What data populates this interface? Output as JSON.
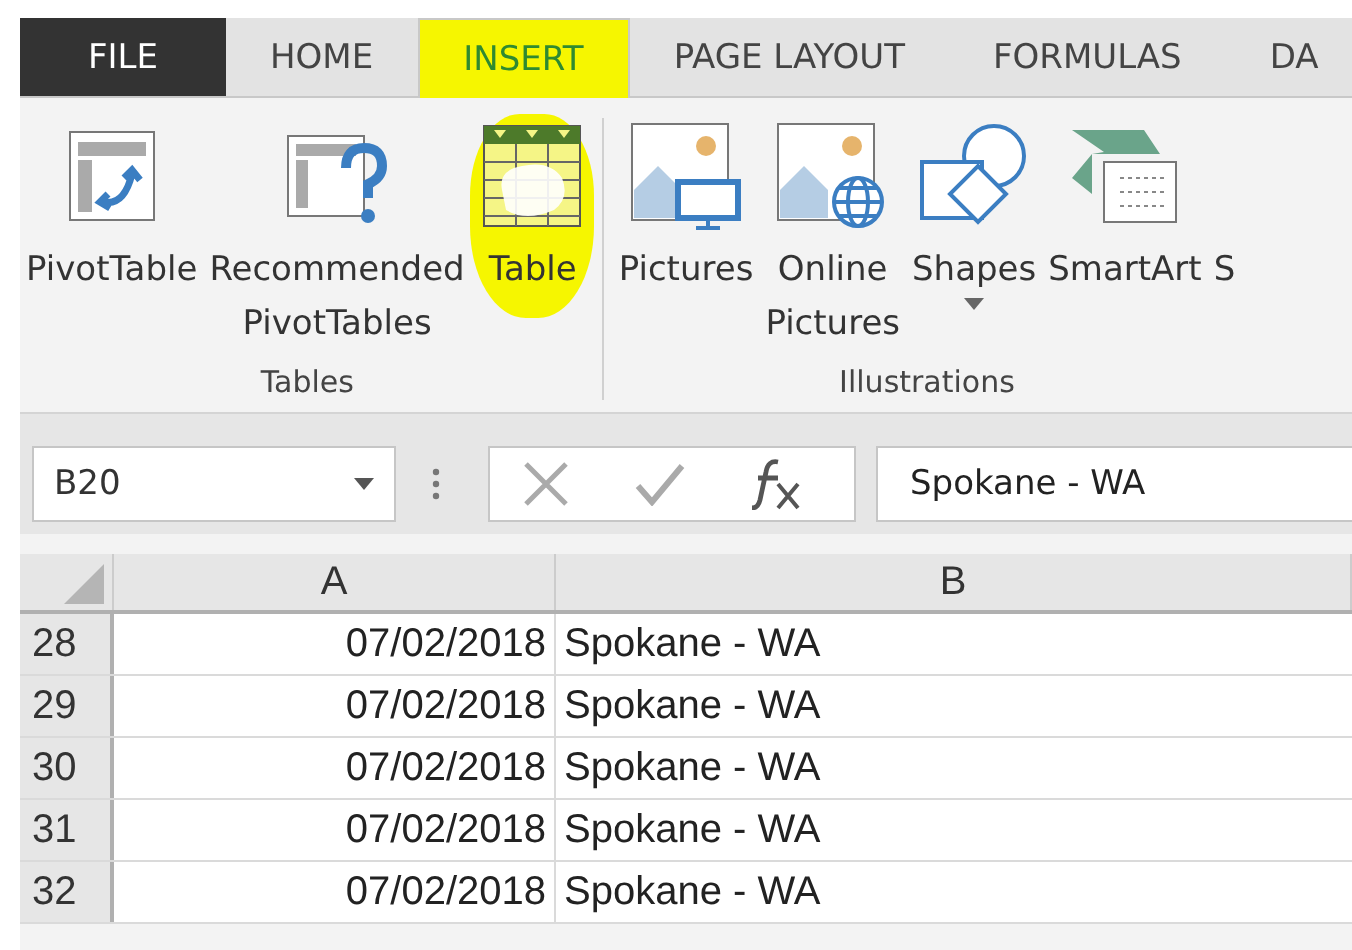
{
  "tabs": [
    {
      "label": "FILE",
      "kind": "file",
      "selected": false,
      "highlighted": false
    },
    {
      "label": "HOME",
      "kind": "tab",
      "selected": false,
      "highlighted": false
    },
    {
      "label": "INSERT",
      "kind": "tab",
      "selected": true,
      "highlighted": true
    },
    {
      "label": "PAGE LAYOUT",
      "kind": "tab",
      "selected": false,
      "highlighted": false
    },
    {
      "label": "FORMULAS",
      "kind": "tab",
      "selected": false,
      "highlighted": false
    },
    {
      "label": "DA",
      "kind": "tab",
      "selected": false,
      "highlighted": false
    }
  ],
  "ribbon_groups": [
    {
      "label": "Tables",
      "buttons": [
        {
          "lines": [
            "PivotTable"
          ],
          "kind": "pivot",
          "highlighted": false,
          "dropdown": false
        },
        {
          "lines": [
            "Recommended",
            "PivotTables"
          ],
          "kind": "recommended",
          "highlighted": false,
          "dropdown": false
        },
        {
          "lines": [
            "Table"
          ],
          "kind": "table",
          "highlighted": true,
          "dropdown": false
        }
      ]
    },
    {
      "label": "Illustrations",
      "buttons": [
        {
          "lines": [
            "Pictures"
          ],
          "kind": "pictures",
          "highlighted": false,
          "dropdown": false
        },
        {
          "lines": [
            "Online",
            "Pictures"
          ],
          "kind": "online",
          "highlighted": false,
          "dropdown": false
        },
        {
          "lines": [
            "Shapes"
          ],
          "kind": "shapes",
          "highlighted": false,
          "dropdown": true
        },
        {
          "lines": [
            "SmartArt"
          ],
          "kind": "smartart",
          "highlighted": false,
          "dropdown": false
        },
        {
          "lines": [
            "S"
          ],
          "kind": "cut",
          "highlighted": false,
          "dropdown": false
        }
      ]
    }
  ],
  "formula_bar": {
    "name_box": "B20",
    "value": "Spokane - WA"
  },
  "sheet": {
    "columns": [
      "A",
      "B"
    ],
    "rows": [
      {
        "number": "28",
        "cells": [
          "07/02/2018",
          "Spokane - WA"
        ]
      },
      {
        "number": "29",
        "cells": [
          "07/02/2018",
          "Spokane - WA"
        ]
      },
      {
        "number": "30",
        "cells": [
          "07/02/2018",
          "Spokane - WA"
        ]
      },
      {
        "number": "31",
        "cells": [
          "07/02/2018",
          "Spokane - WA"
        ]
      },
      {
        "number": "32",
        "cells": [
          "07/02/2018",
          "Spokane - WA"
        ]
      }
    ]
  }
}
